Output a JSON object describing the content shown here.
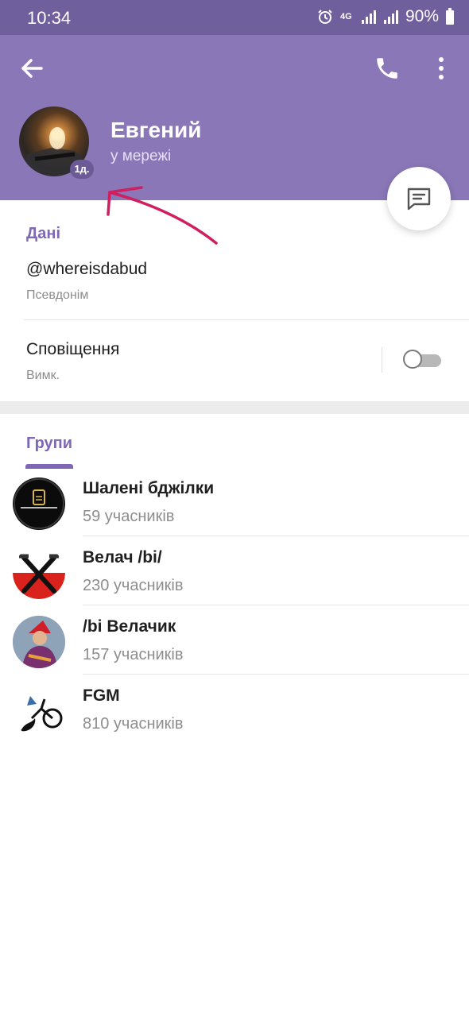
{
  "status_bar": {
    "time": "10:34",
    "network": "4G",
    "battery": "90%",
    "icons": [
      "alarm-icon",
      "network-4g-icon",
      "signal-icon",
      "signal-icon",
      "battery-icon"
    ]
  },
  "header": {
    "back_icon": "arrow-back-icon",
    "call_icon": "phone-icon",
    "menu_icon": "more-vert-icon",
    "name": "Евгений",
    "presence": "у мережі",
    "avatar_badge": "1д.",
    "message_icon": "message-icon",
    "bg_color": "#8a77b8"
  },
  "info": {
    "section_title": "Дані",
    "username": "@whereisdabud",
    "username_label": "Псевдонім",
    "notifications_label": "Сповіщення",
    "notifications_status": "Вимк.",
    "notifications_enabled": false
  },
  "groups": {
    "section_title": "Групи",
    "items": [
      {
        "name": "Шалені бджілки",
        "members": "59 учасників"
      },
      {
        "name": "Велач /bi/",
        "members": "230 учасників"
      },
      {
        "name": "/bi Велачик",
        "members": "157 учасників"
      },
      {
        "name": "FGM",
        "members": "810 учасників"
      }
    ]
  },
  "colors": {
    "accent": "#7e67b5",
    "annotation": "#d01e5e"
  }
}
